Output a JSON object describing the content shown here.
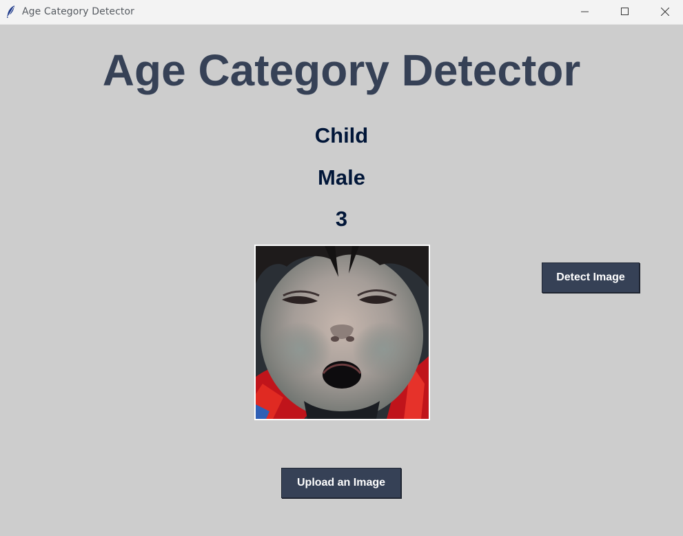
{
  "window": {
    "title": "Age Category Detector",
    "app_icon": "feather-icon",
    "controls": [
      "minimize-icon",
      "maximize-icon",
      "close-icon"
    ]
  },
  "main": {
    "heading": "Age Category Detector",
    "results": {
      "age_category": "Child",
      "gender": "Male",
      "age": "3"
    },
    "image_description": "uploaded face photo"
  },
  "buttons": {
    "detect_label": "Detect Image",
    "upload_label": "Upload an Image"
  },
  "colors": {
    "background": "#cdcdcd",
    "heading": "#364156",
    "result_text": "#011638",
    "button_bg": "#364156",
    "button_text": "#ffffff"
  }
}
